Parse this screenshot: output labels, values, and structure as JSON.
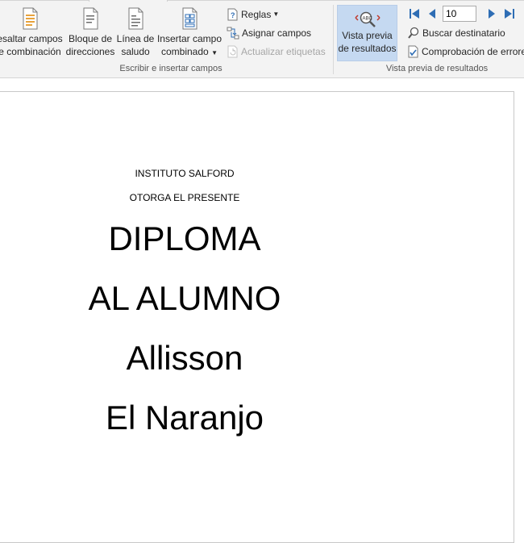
{
  "ribbon": {
    "highlight_fields": {
      "line1": "esaltar campos",
      "line2": "e combinación"
    },
    "address_block": {
      "line1": "Bloque de",
      "line2": "direcciones"
    },
    "greeting_line": {
      "line1": "Línea de",
      "line2": "saludo"
    },
    "insert_field": {
      "line1": "Insertar campo",
      "line2": "combinado"
    },
    "rules_label": "Reglas",
    "match_fields_label": "Asignar campos",
    "update_labels_label": "Actualizar etiquetas",
    "write_group_label": "Escribir e insertar campos",
    "preview_results": {
      "line1": "Vista previa",
      "line2": "de resultados"
    },
    "record_number": "10",
    "find_recipient_label": "Buscar destinatario",
    "check_errors_label": "Comprobación de errores",
    "preview_group_label": "Vista previa de resultados"
  },
  "document": {
    "line1": "INSTITUTO SALFORD",
    "line2": "OTORGA EL PRESENTE",
    "line3": "DIPLOMA",
    "line4": "AL ALUMNO",
    "line5": "Allisson",
    "line6": "El Naranjo"
  }
}
